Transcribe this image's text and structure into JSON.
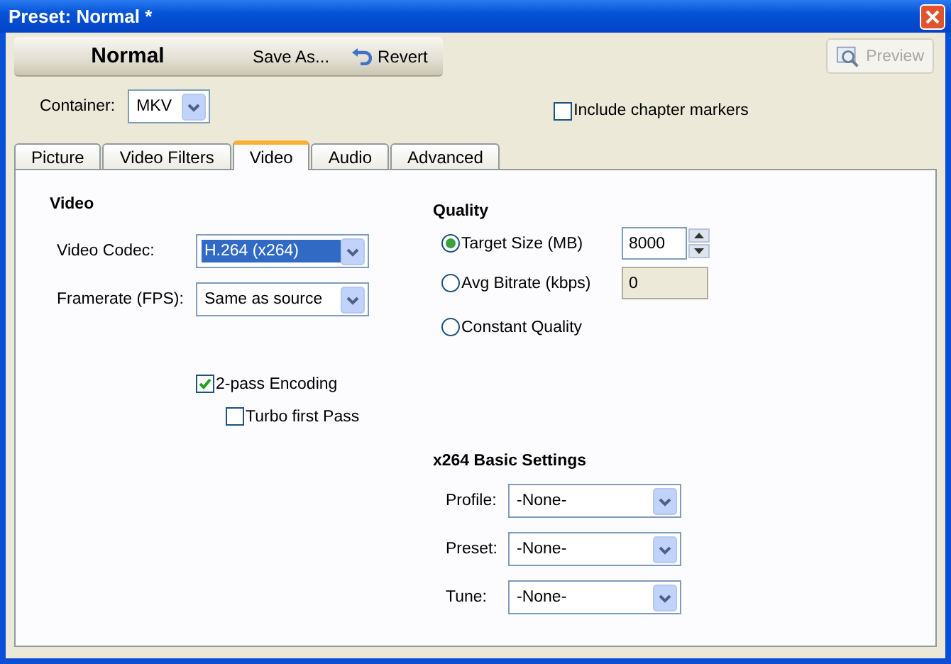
{
  "window": {
    "title": "Preset: Normal *"
  },
  "toolbar": {
    "preset_name": "Normal",
    "buttons": [
      {
        "kind": "plain",
        "label": "Save As..."
      },
      {
        "kind": "revert",
        "label": "Revert"
      }
    ],
    "preview": {
      "label": "Preview",
      "disabled": true
    }
  },
  "container": {
    "label": "Container:",
    "value": "MKV"
  },
  "chapter_markers": {
    "label": "Include chapter markers",
    "checked": false
  },
  "tabs": [
    {
      "label": "Picture",
      "selected": false
    },
    {
      "label": "Video Filters",
      "selected": false
    },
    {
      "label": "Video",
      "selected": true
    },
    {
      "label": "Audio",
      "selected": false
    },
    {
      "label": "Advanced",
      "selected": false
    }
  ],
  "video": {
    "heading": "Video",
    "fields": [
      {
        "label": "Video Codec:",
        "value": "H.264 (x264)",
        "focused": true
      },
      {
        "label": "Framerate (FPS):",
        "value": "Same as source",
        "focused": false
      }
    ],
    "checkboxes": [
      {
        "label": "2-pass Encoding",
        "checked": true,
        "children": [
          {
            "label": "Turbo first Pass",
            "checked": false
          }
        ]
      }
    ]
  },
  "quality": {
    "heading": "Quality",
    "options": [
      {
        "label": "Target Size (MB)",
        "selected": true,
        "field": {
          "value": "8000",
          "disabled": false,
          "spinner": true
        }
      },
      {
        "label": "Avg Bitrate (kbps)",
        "selected": false,
        "field": {
          "value": "0",
          "disabled": true,
          "spinner": false
        }
      },
      {
        "label": "Constant Quality",
        "selected": false
      }
    ]
  },
  "x264": {
    "heading": "x264 Basic Settings",
    "fields": [
      {
        "label": "Profile:",
        "value": "-None-"
      },
      {
        "label": "Preset:",
        "value": "-None-"
      },
      {
        "label": "Tune:",
        "value": "-None-"
      }
    ]
  }
}
